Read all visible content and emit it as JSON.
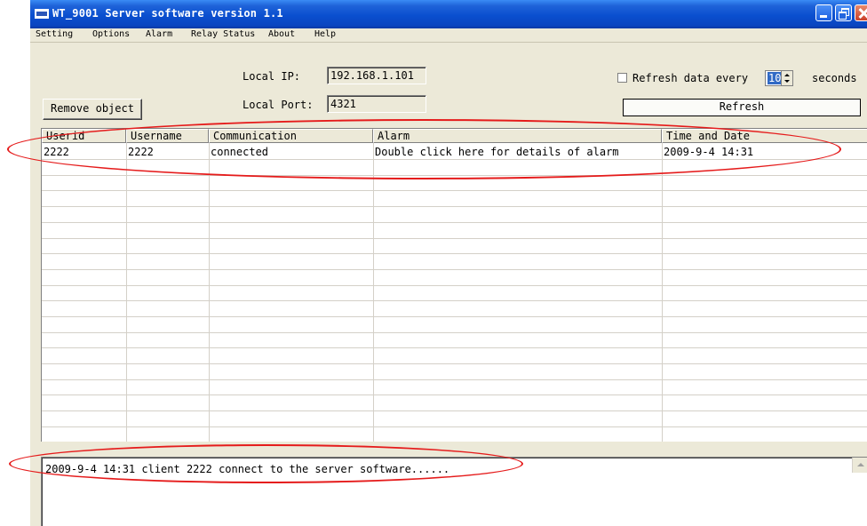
{
  "window": {
    "title": "WT_9001 Server software version 1.1"
  },
  "menu": {
    "items": [
      "Setting",
      "Options",
      "Alarm",
      "Relay Status",
      "About",
      "Help"
    ]
  },
  "controls": {
    "local_ip_label": "Local   IP:",
    "local_ip_value": "192.168.1.101",
    "local_port_label": "Local Port:",
    "local_port_value": "4321",
    "remove_button": "Remove object",
    "refresh_checkbox_label": "Refresh data every",
    "refresh_checked": false,
    "refresh_interval": "10",
    "seconds_label": "seconds",
    "refresh_button": "Refresh"
  },
  "table": {
    "columns": [
      "Userid",
      "Username",
      "Communication",
      "Alarm",
      "Time and Date"
    ],
    "rows": [
      [
        "2222",
        "2222",
        "connected",
        "Double click here for details of alarm",
        "2009-9-4  14:31"
      ]
    ]
  },
  "log": {
    "lines": [
      "2009-9-4  14:31 client 2222 connect to the server software......"
    ]
  },
  "colors": {
    "annotation": "#e51b1b",
    "titlebar": "#0a4fcf",
    "face": "#ece9d8"
  }
}
